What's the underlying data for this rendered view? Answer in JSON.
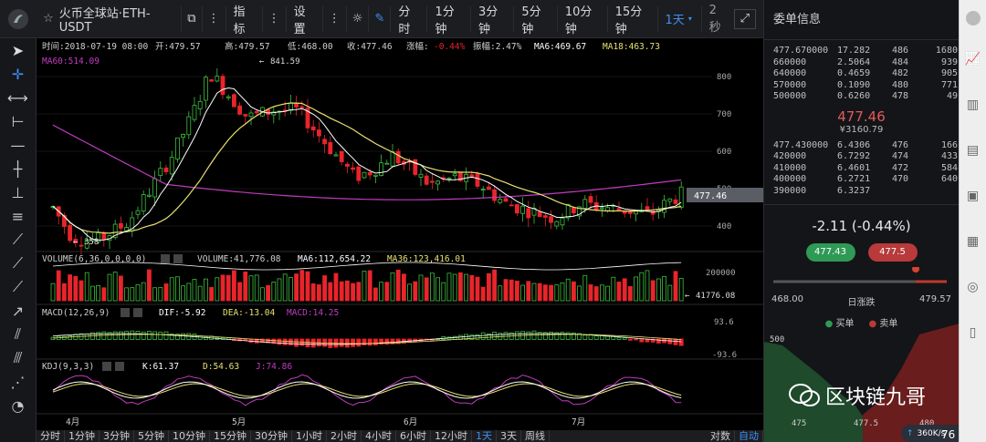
{
  "toolbar": {
    "symbol": "火币全球站·ETH-USDT",
    "indicator": "指标",
    "settings": "设置",
    "periods": [
      "分时",
      "1分钟",
      "3分钟",
      "5分钟",
      "10分钟",
      "15分钟"
    ],
    "period_active": "1天",
    "refresh": "2秒"
  },
  "info": {
    "time": "时间:2018-07-19 08:00",
    "open": "开:479.57",
    "high": "高:479.57",
    "low": "低:468.00",
    "close": "收:477.46",
    "chg_label": "涨幅:",
    "chg_val": "-0.44%",
    "amp": "振幅:2.47%",
    "ma6": "MA6:469.67",
    "ma18": "MA18:463.73",
    "ma60": "MA60:514.09",
    "max_label": "841.59",
    "min_label": "358",
    "current_tag": "477.46"
  },
  "price_axis": [
    "800",
    "700",
    "600",
    "500",
    "400"
  ],
  "volume": {
    "label": "VOLUME(6,36,0,0,0,0)",
    "value": "VOLUME:41,776.08",
    "ma6": "MA6:112,654.22",
    "ma36": "MA36:123,416.01",
    "axis": "200000",
    "current": "41776.08"
  },
  "macd": {
    "label": "MACD(12,26,9)",
    "dif": "DIF:-5.92",
    "dea": "DEA:-13.04",
    "macd": "MACD:14.25",
    "axis_top": "93.6",
    "axis_bottom": "-93.6"
  },
  "kdj": {
    "label": "KDJ(9,3,3)",
    "k": "K:61.37",
    "d": "D:54.63",
    "j": "J:74.86"
  },
  "time_axis": [
    "4月",
    "5月",
    "6月",
    "7月"
  ],
  "bottom_periods": [
    "分时",
    "1分钟",
    "3分钟",
    "5分钟",
    "10分钟",
    "15分钟",
    "30分钟",
    "1小时",
    "2小时",
    "4小时",
    "6小时",
    "12小时",
    "1天",
    "3天",
    "周线"
  ],
  "bottom_active": "1天",
  "bottom_right": [
    "对数",
    "自动"
  ],
  "orderbook": {
    "title": "委单信息",
    "asks": [
      [
        "477.670000",
        "17.282",
        "486",
        "1680"
      ],
      [
        "660000",
        "2.5064",
        "484",
        "939"
      ],
      [
        "640000",
        "0.4659",
        "482",
        "905"
      ],
      [
        "570000",
        "0.1090",
        "480",
        "771"
      ],
      [
        "500000",
        "0.6260",
        "478",
        "49"
      ]
    ],
    "last_price": "477.46",
    "last_cny": "¥3160.79",
    "bids": [
      [
        "477.430000",
        "6.4306",
        "476",
        "166"
      ],
      [
        "420000",
        "6.7292",
        "474",
        "433"
      ],
      [
        "410000",
        "6.4601",
        "472",
        "584"
      ],
      [
        "400000",
        "6.2721",
        "470",
        "640"
      ],
      [
        "390000",
        "6.3237",
        "",
        ""
      ]
    ],
    "change": "-2.11 (-0.44%)",
    "best_bid": "477.43",
    "best_ask": "477.5",
    "range_low": "468.00",
    "range_label": "日涨跌",
    "range_high": "479.57",
    "legend_buy": "买单",
    "legend_sell": "卖单",
    "depth_axis_y": "500",
    "depth_axis_x": [
      "475",
      "477.5",
      "480"
    ],
    "speed": "360K/s",
    "speed_pct": "76"
  },
  "watermark": "区块链九哥",
  "colors": {
    "up": "#3fbf3f",
    "down": "#e8252b",
    "accent": "#3f8ff4",
    "ma60": "#c03cc0",
    "ma18": "#e8e070",
    "ma6": "#ffffff"
  }
}
